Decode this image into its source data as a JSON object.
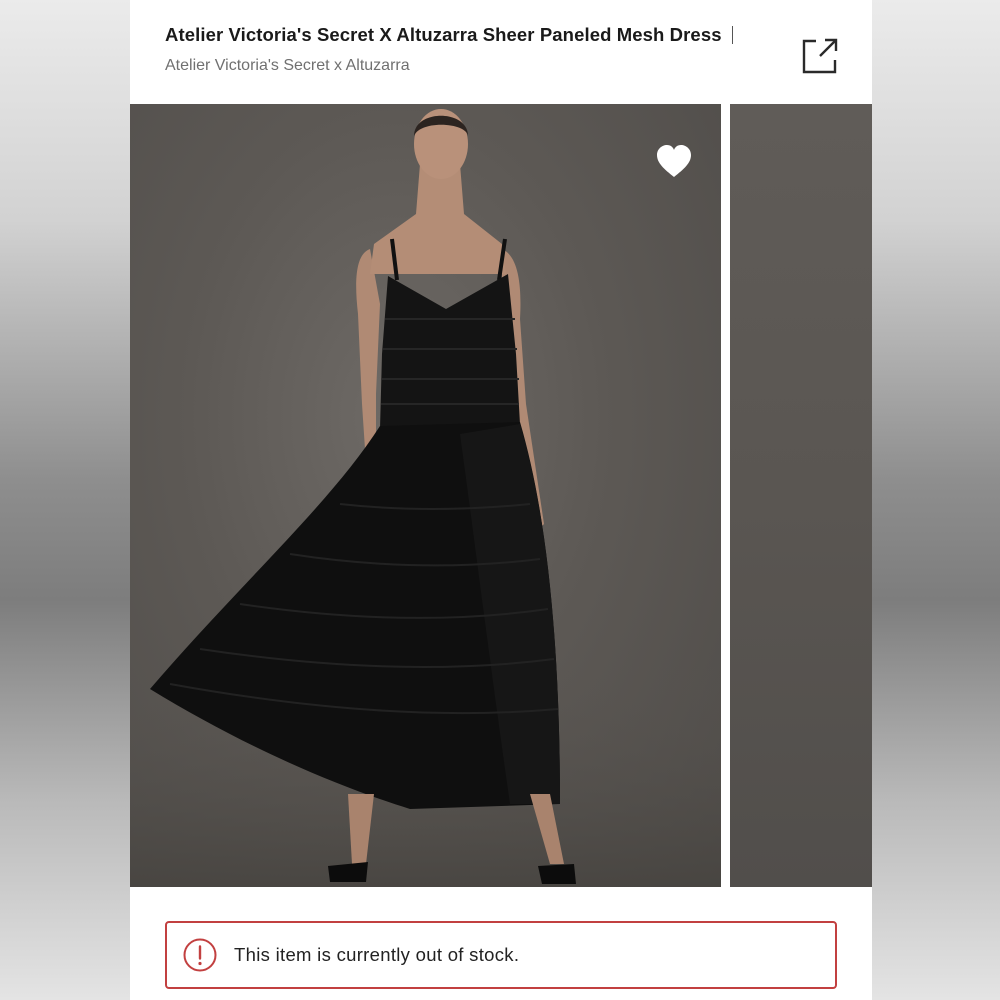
{
  "product": {
    "title": "Atelier Victoria's Secret X Altuzarra Sheer Paneled Mesh Dress",
    "brand": "Atelier Victoria's Secret x Altuzarra"
  },
  "actions": {
    "share_icon": "share-icon",
    "like_icon": "heart-icon"
  },
  "alert": {
    "message": "This item is currently out of stock.",
    "icon": "alert-circle-icon",
    "color": "#c24040"
  },
  "colors": {
    "photo_background": "#5d5955",
    "dress": "#0e0e0e"
  }
}
